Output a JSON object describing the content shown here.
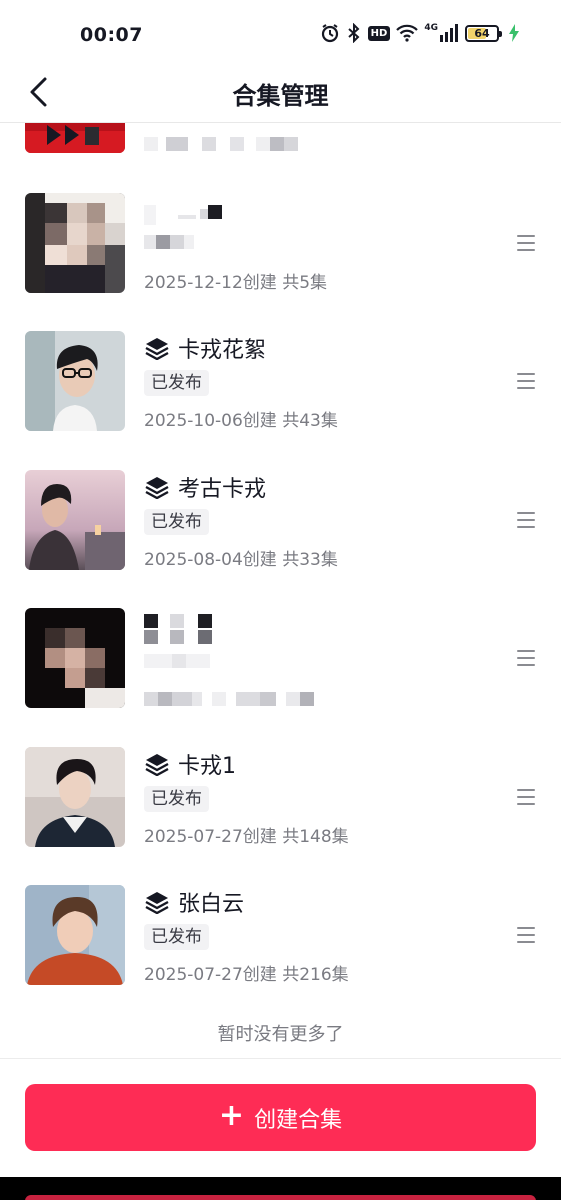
{
  "status_bar": {
    "time": "00:07",
    "network": "4G",
    "hd": "HD",
    "battery": "64",
    "battery_level": 0.64,
    "icons": [
      "alarm-icon",
      "bluetooth-icon",
      "hd-icon",
      "wifi-icon",
      "cellular-signal-icon",
      "battery-icon",
      "charging-icon"
    ]
  },
  "nav": {
    "back_icon": "chevron-left-icon",
    "title": "合集管理"
  },
  "collections": [
    {
      "title": "",
      "status": "",
      "meta": "",
      "obscured": true,
      "thumb": "red-graphic"
    },
    {
      "title": "",
      "status": "",
      "meta": "2025-12-12创建 共5集",
      "obscured": true,
      "thumb": "pixelated-portrait"
    },
    {
      "title": "卡戎花絮",
      "status": "已发布",
      "meta": "2025-10-06创建 共43集",
      "obscured": false,
      "thumb": "portrait-glasses"
    },
    {
      "title": "考古卡戎",
      "status": "已发布",
      "meta": "2025-08-04创建 共33集",
      "obscured": false,
      "thumb": "portrait-city-dusk"
    },
    {
      "title": "",
      "status": "",
      "meta": "",
      "obscured": true,
      "thumb": "pixelated-portrait-dark"
    },
    {
      "title": "卡戎1",
      "status": "已发布",
      "meta": "2025-07-27创建 共148集",
      "obscured": false,
      "thumb": "portrait-suit"
    },
    {
      "title": "张白云",
      "status": "已发布",
      "meta": "2025-07-27创建 共216集",
      "obscured": false,
      "thumb": "portrait-orange"
    }
  ],
  "list_end_text": "暂时没有更多了",
  "create_button": {
    "icon": "plus-icon",
    "label": "创建合集"
  },
  "colors": {
    "accent": "#fe2c55",
    "badge_bg": "#f2f2f4",
    "meta_text": "#7a7b82"
  }
}
